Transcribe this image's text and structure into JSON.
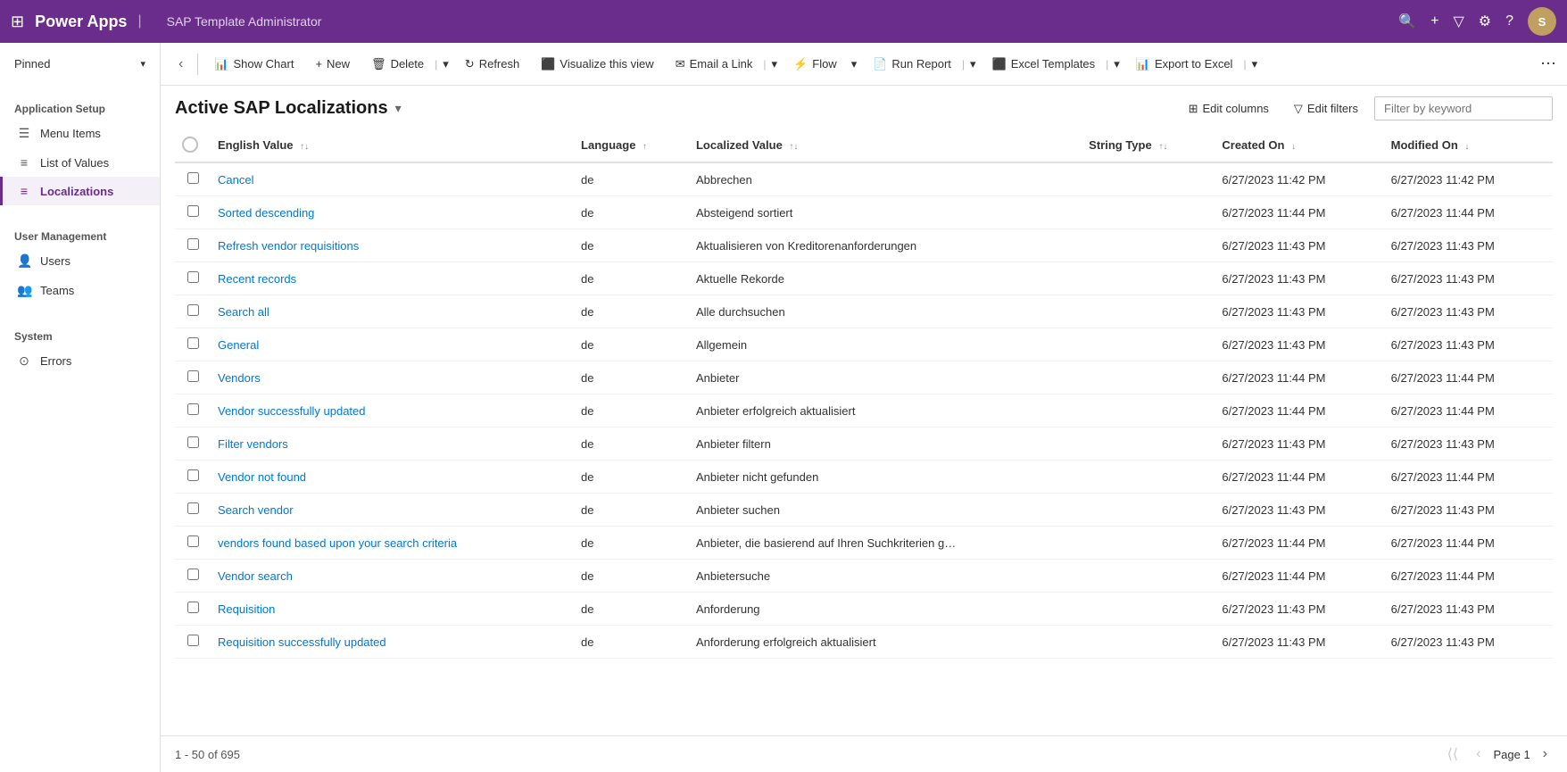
{
  "topNav": {
    "appName": "Power Apps",
    "pageName": "SAP Template Administrator"
  },
  "toolbar": {
    "backLabel": "‹",
    "showChartLabel": "Show Chart",
    "newLabel": "New",
    "deleteLabel": "Delete",
    "refreshLabel": "Refresh",
    "visualizeLabel": "Visualize this view",
    "emailLinkLabel": "Email a Link",
    "flowLabel": "Flow",
    "runReportLabel": "Run Report",
    "excelTemplatesLabel": "Excel Templates",
    "exportToExcelLabel": "Export to Excel"
  },
  "pageHeader": {
    "title": "Active SAP Localizations",
    "editColumnsLabel": "Edit columns",
    "editFiltersLabel": "Edit filters",
    "filterPlaceholder": "Filter by keyword"
  },
  "table": {
    "columns": [
      {
        "id": "english_value",
        "label": "English Value",
        "sortable": true,
        "sortDir": "asc"
      },
      {
        "id": "language",
        "label": "Language",
        "sortable": true,
        "sortDir": "asc"
      },
      {
        "id": "localized_value",
        "label": "Localized Value",
        "sortable": true,
        "sortDir": "asc"
      },
      {
        "id": "string_type",
        "label": "String Type",
        "sortable": true
      },
      {
        "id": "created_on",
        "label": "Created On",
        "sortable": true,
        "sortDir": "desc"
      },
      {
        "id": "modified_on",
        "label": "Modified On",
        "sortable": true,
        "sortDir": "desc"
      }
    ],
    "rows": [
      {
        "english_value": "Cancel",
        "language": "de",
        "localized_value": "Abbrechen",
        "string_type": "",
        "created_on": "6/27/2023 11:42 PM",
        "modified_on": "6/27/2023 11:42 PM"
      },
      {
        "english_value": "Sorted descending",
        "language": "de",
        "localized_value": "Absteigend sortiert",
        "string_type": "",
        "created_on": "6/27/2023 11:44 PM",
        "modified_on": "6/27/2023 11:44 PM"
      },
      {
        "english_value": "Refresh vendor requisitions",
        "language": "de",
        "localized_value": "Aktualisieren von Kreditorenanforderungen",
        "string_type": "",
        "created_on": "6/27/2023 11:43 PM",
        "modified_on": "6/27/2023 11:43 PM"
      },
      {
        "english_value": "Recent records",
        "language": "de",
        "localized_value": "Aktuelle Rekorde",
        "string_type": "",
        "created_on": "6/27/2023 11:43 PM",
        "modified_on": "6/27/2023 11:43 PM"
      },
      {
        "english_value": "Search all",
        "language": "de",
        "localized_value": "Alle durchsuchen",
        "string_type": "",
        "created_on": "6/27/2023 11:43 PM",
        "modified_on": "6/27/2023 11:43 PM"
      },
      {
        "english_value": "General",
        "language": "de",
        "localized_value": "Allgemein",
        "string_type": "",
        "created_on": "6/27/2023 11:43 PM",
        "modified_on": "6/27/2023 11:43 PM"
      },
      {
        "english_value": "Vendors",
        "language": "de",
        "localized_value": "Anbieter",
        "string_type": "",
        "created_on": "6/27/2023 11:44 PM",
        "modified_on": "6/27/2023 11:44 PM"
      },
      {
        "english_value": "Vendor successfully updated",
        "language": "de",
        "localized_value": "Anbieter erfolgreich aktualisiert",
        "string_type": "",
        "created_on": "6/27/2023 11:44 PM",
        "modified_on": "6/27/2023 11:44 PM"
      },
      {
        "english_value": "Filter vendors",
        "language": "de",
        "localized_value": "Anbieter filtern",
        "string_type": "",
        "created_on": "6/27/2023 11:43 PM",
        "modified_on": "6/27/2023 11:43 PM"
      },
      {
        "english_value": "Vendor not found",
        "language": "de",
        "localized_value": "Anbieter nicht gefunden",
        "string_type": "",
        "created_on": "6/27/2023 11:44 PM",
        "modified_on": "6/27/2023 11:44 PM"
      },
      {
        "english_value": "Search vendor",
        "language": "de",
        "localized_value": "Anbieter suchen",
        "string_type": "",
        "created_on": "6/27/2023 11:43 PM",
        "modified_on": "6/27/2023 11:43 PM"
      },
      {
        "english_value": "vendors found based upon your search criteria",
        "language": "de",
        "localized_value": "Anbieter, die basierend auf Ihren Suchkriterien g…",
        "string_type": "",
        "created_on": "6/27/2023 11:44 PM",
        "modified_on": "6/27/2023 11:44 PM"
      },
      {
        "english_value": "Vendor search",
        "language": "de",
        "localized_value": "Anbietersuche",
        "string_type": "",
        "created_on": "6/27/2023 11:44 PM",
        "modified_on": "6/27/2023 11:44 PM"
      },
      {
        "english_value": "Requisition",
        "language": "de",
        "localized_value": "Anforderung",
        "string_type": "",
        "created_on": "6/27/2023 11:43 PM",
        "modified_on": "6/27/2023 11:43 PM"
      },
      {
        "english_value": "Requisition successfully updated",
        "language": "de",
        "localized_value": "Anforderung erfolgreich aktualisiert",
        "string_type": "",
        "created_on": "6/27/2023 11:43 PM",
        "modified_on": "6/27/2023 11:43 PM"
      }
    ]
  },
  "footer": {
    "recordRange": "1 - 50 of 695",
    "pageLabel": "Page 1"
  },
  "sidebar": {
    "pinnedLabel": "Pinned",
    "groups": [
      {
        "label": "Application Setup",
        "items": [
          {
            "id": "menu-items",
            "label": "Menu Items",
            "icon": "☰",
            "active": false
          },
          {
            "id": "list-of-values",
            "label": "List of Values",
            "icon": "≡",
            "active": false
          },
          {
            "id": "localizations",
            "label": "Localizations",
            "icon": "≡",
            "active": true
          }
        ]
      },
      {
        "label": "User Management",
        "items": [
          {
            "id": "users",
            "label": "Users",
            "icon": "👤",
            "active": false
          },
          {
            "id": "teams",
            "label": "Teams",
            "icon": "👥",
            "active": false
          }
        ]
      },
      {
        "label": "System",
        "items": [
          {
            "id": "errors",
            "label": "Errors",
            "icon": "⊙",
            "active": false
          }
        ]
      }
    ]
  }
}
